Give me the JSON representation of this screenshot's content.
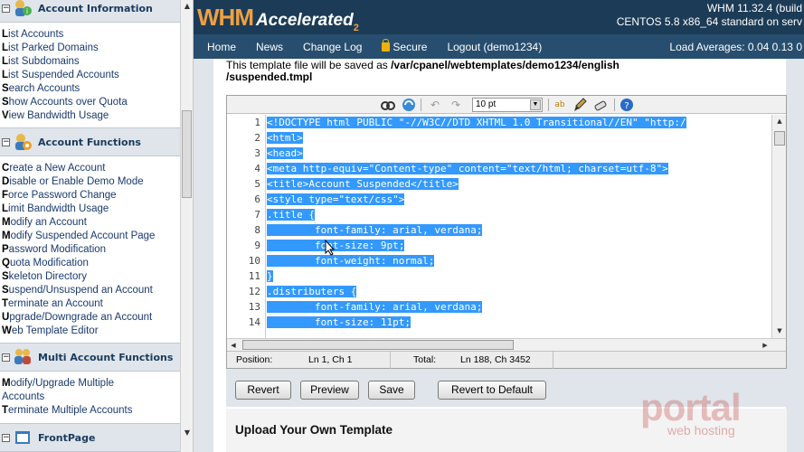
{
  "sidebar": {
    "sections": [
      {
        "title": "Account Information",
        "toggle": "−",
        "links": [
          {
            "first": "L",
            "rest": "ist Accounts"
          },
          {
            "first": "L",
            "rest": "ist Parked Domains"
          },
          {
            "first": "L",
            "rest": "ist Subdomains"
          },
          {
            "first": "L",
            "rest": "ist Suspended Accounts"
          },
          {
            "first": "S",
            "rest": "earch Accounts"
          },
          {
            "first": "S",
            "rest": "how Accounts over Quota"
          },
          {
            "first": "V",
            "rest": "iew Bandwidth Usage"
          }
        ]
      },
      {
        "title": "Account Functions",
        "toggle": "−",
        "links": [
          {
            "first": "C",
            "rest": "reate a New Account"
          },
          {
            "first": "D",
            "rest": "isable or Enable Demo Mode"
          },
          {
            "first": "F",
            "rest": "orce Password Change"
          },
          {
            "first": "L",
            "rest": "imit Bandwidth Usage"
          },
          {
            "first": "M",
            "rest": "odify an Account"
          },
          {
            "first": "M",
            "rest": "odify Suspended Account Page"
          },
          {
            "first": "P",
            "rest": "assword Modification"
          },
          {
            "first": "Q",
            "rest": "uota Modification"
          },
          {
            "first": "S",
            "rest": "keleton Directory"
          },
          {
            "first": "S",
            "rest": "uspend/Unsuspend an Account"
          },
          {
            "first": "T",
            "rest": "erminate an Account"
          },
          {
            "first": "U",
            "rest": "pgrade/Downgrade an Account"
          },
          {
            "first": "W",
            "rest": "eb Template Editor"
          }
        ]
      },
      {
        "title": "Multi Account Functions",
        "toggle": "−",
        "links": [
          {
            "first": "M",
            "rest": "odify/Upgrade Multiple"
          },
          {
            "first": "",
            "rest": "Accounts"
          },
          {
            "first": "T",
            "rest": "erminate Multiple Accounts"
          }
        ]
      },
      {
        "title": "FrontPage",
        "toggle": "−",
        "links": []
      }
    ]
  },
  "header": {
    "logo_main": "WHM",
    "logo_sub": "Accelerated",
    "logo_num": "2",
    "version_line1": "WHM 11.32.4 (build",
    "version_line2": "CENTOS 5.8 x86_64 standard on serv",
    "load_averages": "Load Averages: 0.04 0.13 0"
  },
  "nav": {
    "home": "Home",
    "news": "News",
    "changelog": "Change Log",
    "secure": "Secure",
    "logout": "Logout (demo1234)"
  },
  "content": {
    "save_note_prefix": "This template file will be saved as ",
    "save_path_part1": "/var/cpanel/webtemplates/demo1234/english",
    "save_path_part2": "/suspended.tmpl"
  },
  "editor": {
    "font_size": "10 pt",
    "line_numbers": [
      "1",
      "2",
      "3",
      "4",
      "5",
      "6",
      "7",
      "8",
      "9",
      "10",
      "11",
      "12",
      "13",
      "14"
    ],
    "code_lines": [
      "<!DOCTYPE html PUBLIC \"-//W3C//DTD XHTML 1.0 Transitional//EN\" \"http:/",
      "<html>",
      "<head>",
      "<meta http-equiv=\"Content-type\" content=\"text/html; charset=utf-8\">",
      "<title>Account Suspended</title>",
      "<style type=\"text/css\">",
      ".title {",
      "        font-family: arial, verdana;",
      "        font-size: 9pt;",
      "        font-weight: normal;",
      "}",
      ".distributers {",
      "        font-family: arial, verdana;",
      "        font-size: 11pt;"
    ],
    "status": {
      "position_label": "Position:",
      "position_value": "Ln 1, Ch 1",
      "total_label": "Total:",
      "total_value": "Ln 188, Ch 3452"
    }
  },
  "buttons": {
    "revert": "Revert",
    "preview": "Preview",
    "save": "Save",
    "revert_default": "Revert to Default"
  },
  "upload": {
    "title": "Upload Your Own Template"
  },
  "watermark": {
    "line1": "portal",
    "line2": "web hosting"
  }
}
